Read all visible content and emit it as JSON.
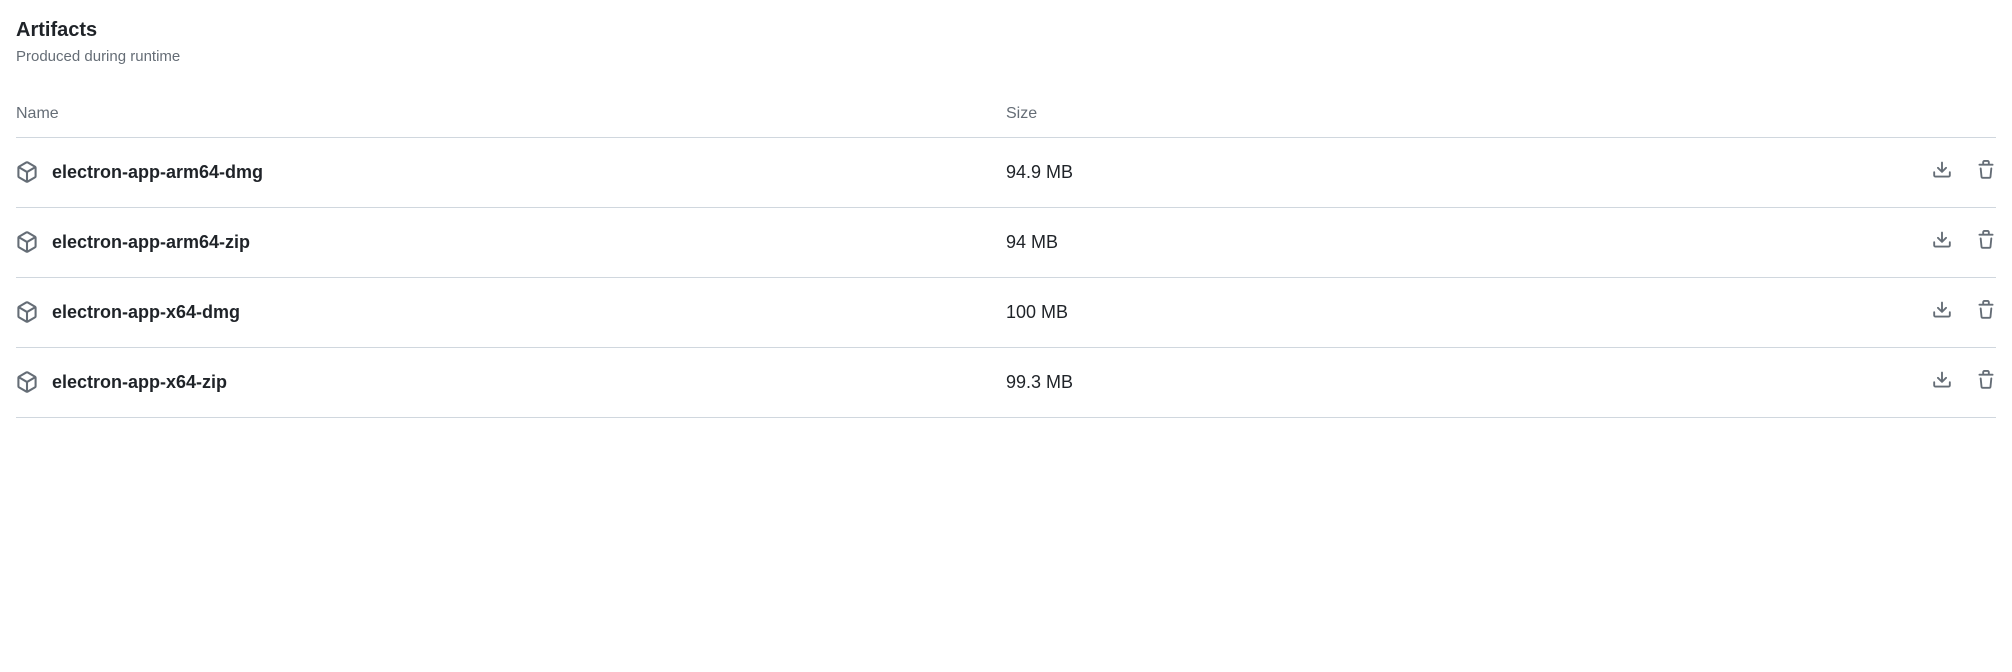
{
  "header": {
    "title": "Artifacts",
    "subtitle": "Produced during runtime"
  },
  "table": {
    "columns": {
      "name": "Name",
      "size": "Size"
    },
    "rows": [
      {
        "name": "electron-app-arm64-dmg",
        "size": "94.9 MB"
      },
      {
        "name": "electron-app-arm64-zip",
        "size": "94 MB"
      },
      {
        "name": "electron-app-x64-dmg",
        "size": "100 MB"
      },
      {
        "name": "electron-app-x64-zip",
        "size": "99.3 MB"
      }
    ]
  }
}
